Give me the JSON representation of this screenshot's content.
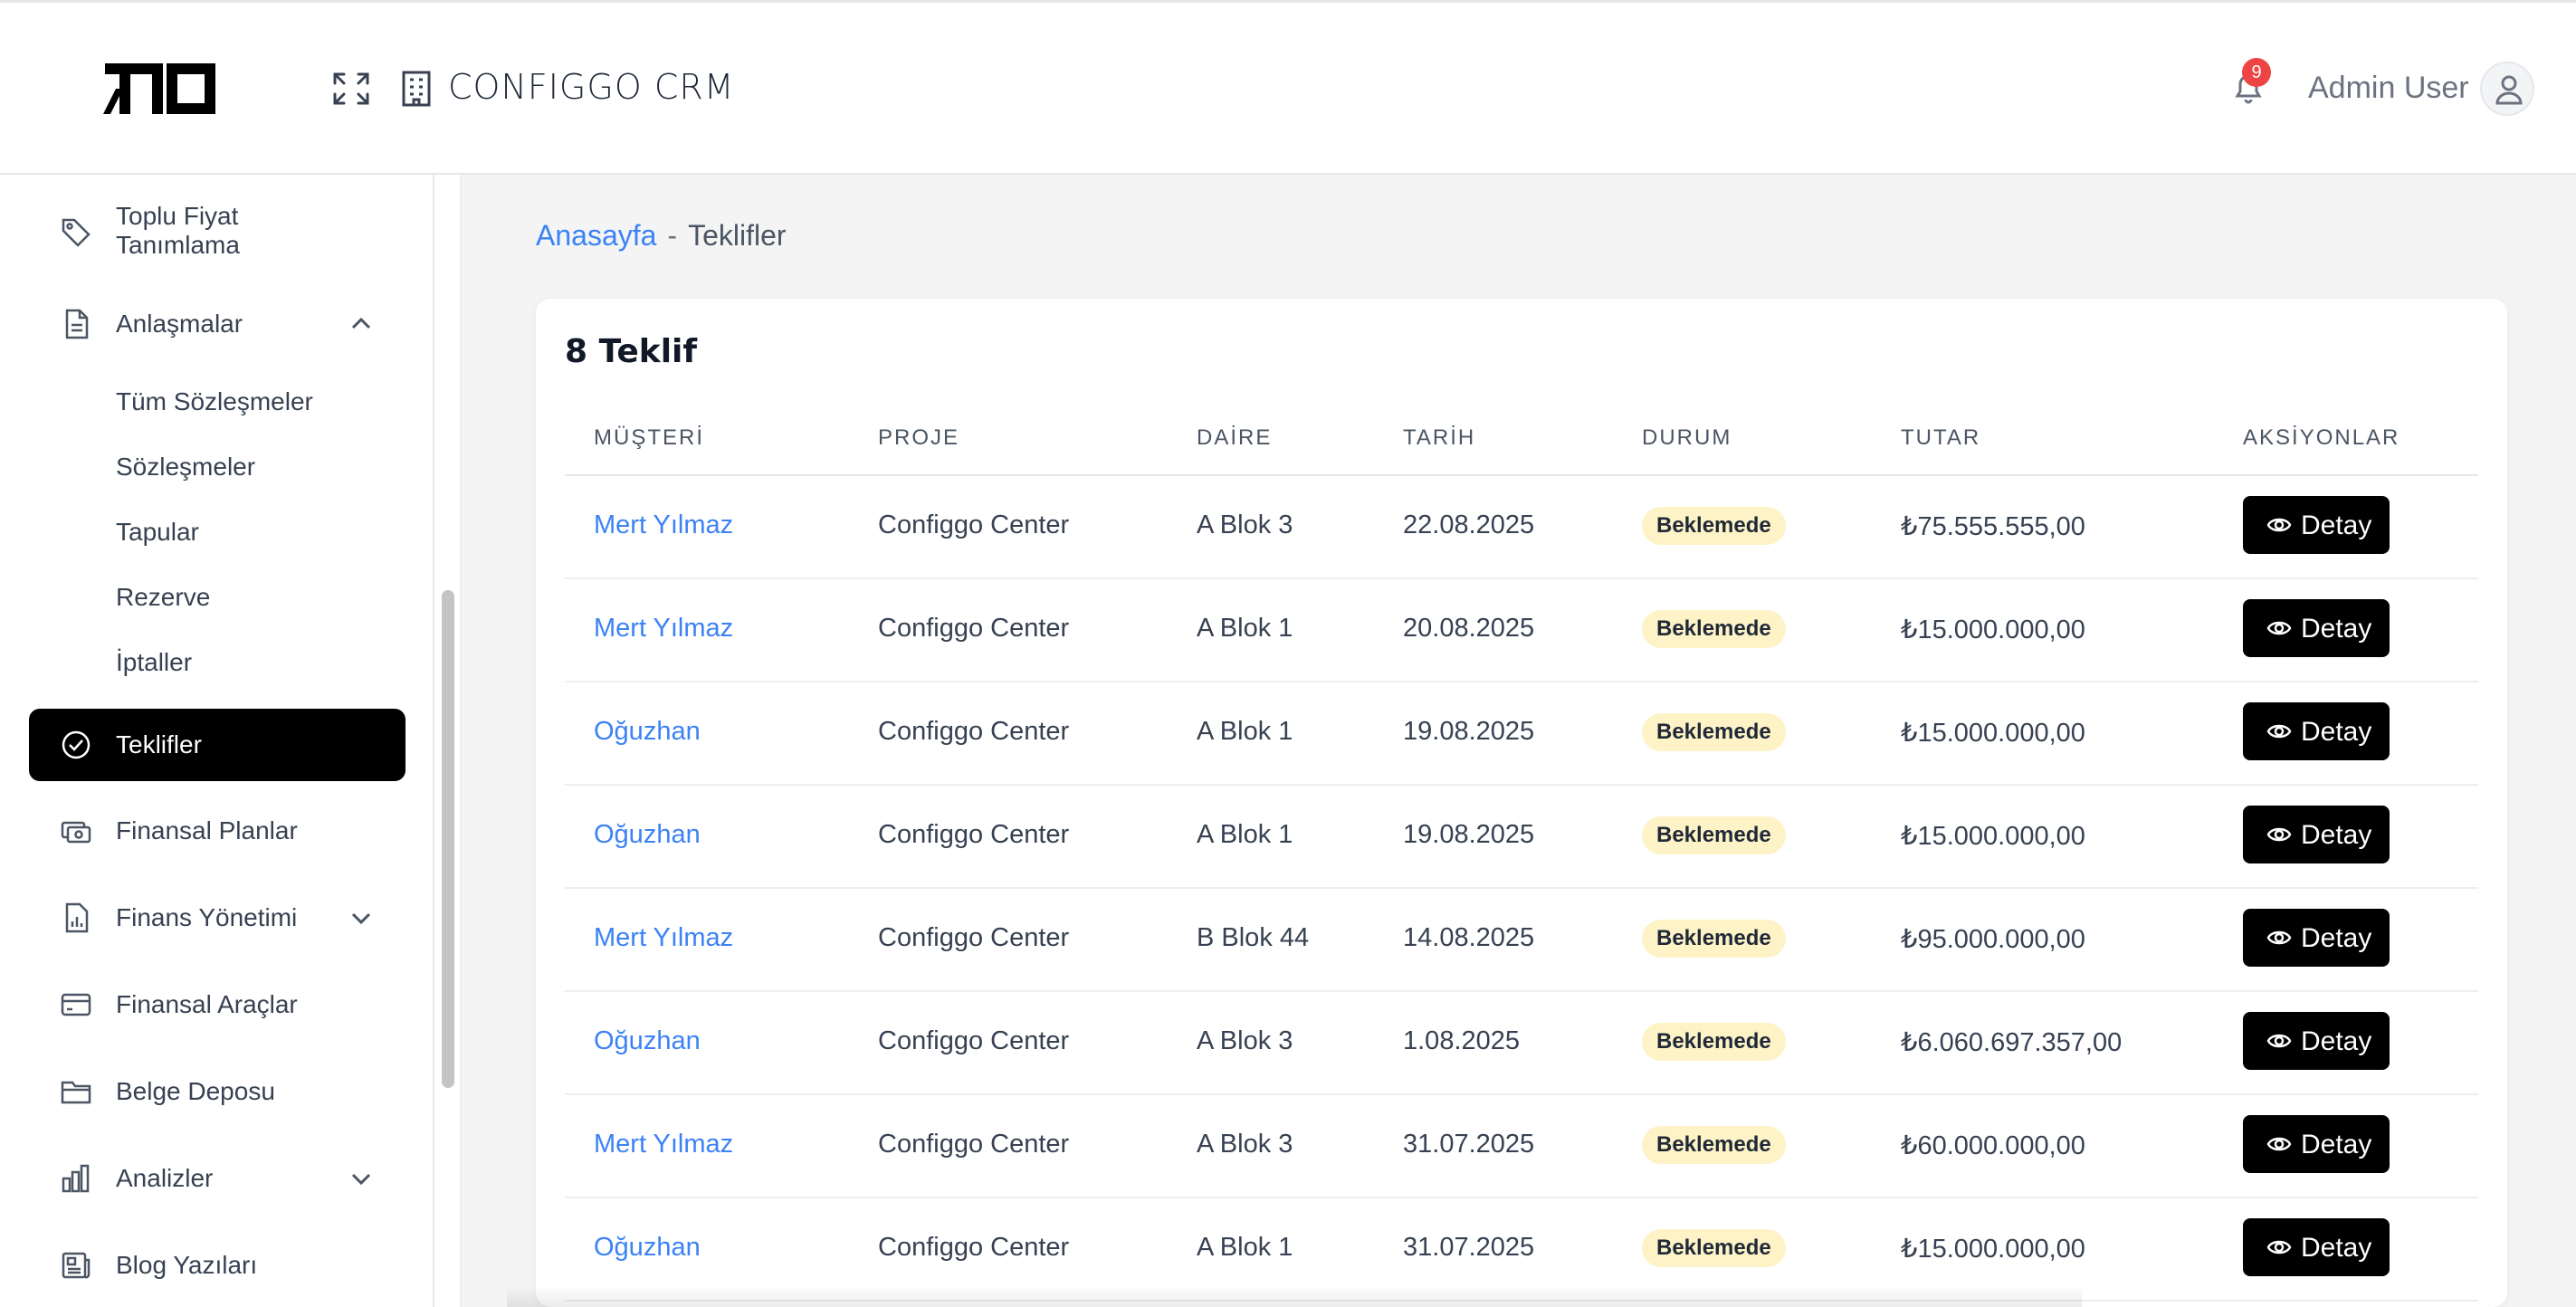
{
  "header": {
    "app_title": "CONFIGGO  CRM",
    "notification_count": "9",
    "user_name": "Admin User"
  },
  "sidebar": {
    "items": [
      {
        "label": "Toplu Fiyat",
        "label2": "Tanımlama",
        "icon": "tag-icon"
      },
      {
        "label": "Anlaşmalar",
        "icon": "document-icon",
        "expanded": true
      },
      {
        "label": "Teklifler",
        "icon": "check-circle-icon",
        "active": true
      },
      {
        "label": "Finansal Planlar",
        "icon": "money-icon"
      },
      {
        "label": "Finans Yönetimi",
        "icon": "report-icon",
        "expanded": false
      },
      {
        "label": "Finansal Araçlar",
        "icon": "card-icon"
      },
      {
        "label": "Belge Deposu",
        "icon": "folder-icon"
      },
      {
        "label": "Analizler",
        "icon": "bar-chart-icon",
        "expanded": false
      },
      {
        "label": "Blog Yazıları",
        "icon": "newspaper-icon"
      }
    ],
    "anlasmalar_children": [
      "Tüm Sözleşmeler",
      "Sözleşmeler",
      "Tapular",
      "Rezerve",
      "İptaller"
    ]
  },
  "breadcrumb": {
    "home": "Anasayfa",
    "separator": "-",
    "current": "Teklifler"
  },
  "offers": {
    "title": "8 Teklif",
    "columns": [
      "MÜŞTERİ",
      "PROJE",
      "DAİRE",
      "TARİH",
      "DURUM",
      "TUTAR",
      "AKSİYONLAR"
    ],
    "action_label": "Detay",
    "status_color": "#fef3c7",
    "rows": [
      {
        "customer": "Mert Yılmaz",
        "project": "Configgo Center",
        "unit": "A Blok 3",
        "date": "22.08.2025",
        "status": "Beklemede",
        "amount": "₺75.555.555,00"
      },
      {
        "customer": "Mert Yılmaz",
        "project": "Configgo Center",
        "unit": "A Blok 1",
        "date": "20.08.2025",
        "status": "Beklemede",
        "amount": "₺15.000.000,00"
      },
      {
        "customer": "Oğuzhan",
        "project": "Configgo Center",
        "unit": "A Blok 1",
        "date": "19.08.2025",
        "status": "Beklemede",
        "amount": "₺15.000.000,00"
      },
      {
        "customer": "Oğuzhan",
        "project": "Configgo Center",
        "unit": "A Blok 1",
        "date": "19.08.2025",
        "status": "Beklemede",
        "amount": "₺15.000.000,00"
      },
      {
        "customer": "Mert Yılmaz",
        "project": "Configgo Center",
        "unit": "B Blok 44",
        "date": "14.08.2025",
        "status": "Beklemede",
        "amount": "₺95.000.000,00"
      },
      {
        "customer": "Oğuzhan",
        "project": "Configgo Center",
        "unit": "A Blok 3",
        "date": "1.08.2025",
        "status": "Beklemede",
        "amount": "₺6.060.697.357,00"
      },
      {
        "customer": "Mert Yılmaz",
        "project": "Configgo Center",
        "unit": "A Blok 3",
        "date": "31.07.2025",
        "status": "Beklemede",
        "amount": "₺60.000.000,00"
      },
      {
        "customer": "Oğuzhan",
        "project": "Configgo Center",
        "unit": "A Blok 1",
        "date": "31.07.2025",
        "status": "Beklemede",
        "amount": "₺15.000.000,00"
      }
    ]
  }
}
